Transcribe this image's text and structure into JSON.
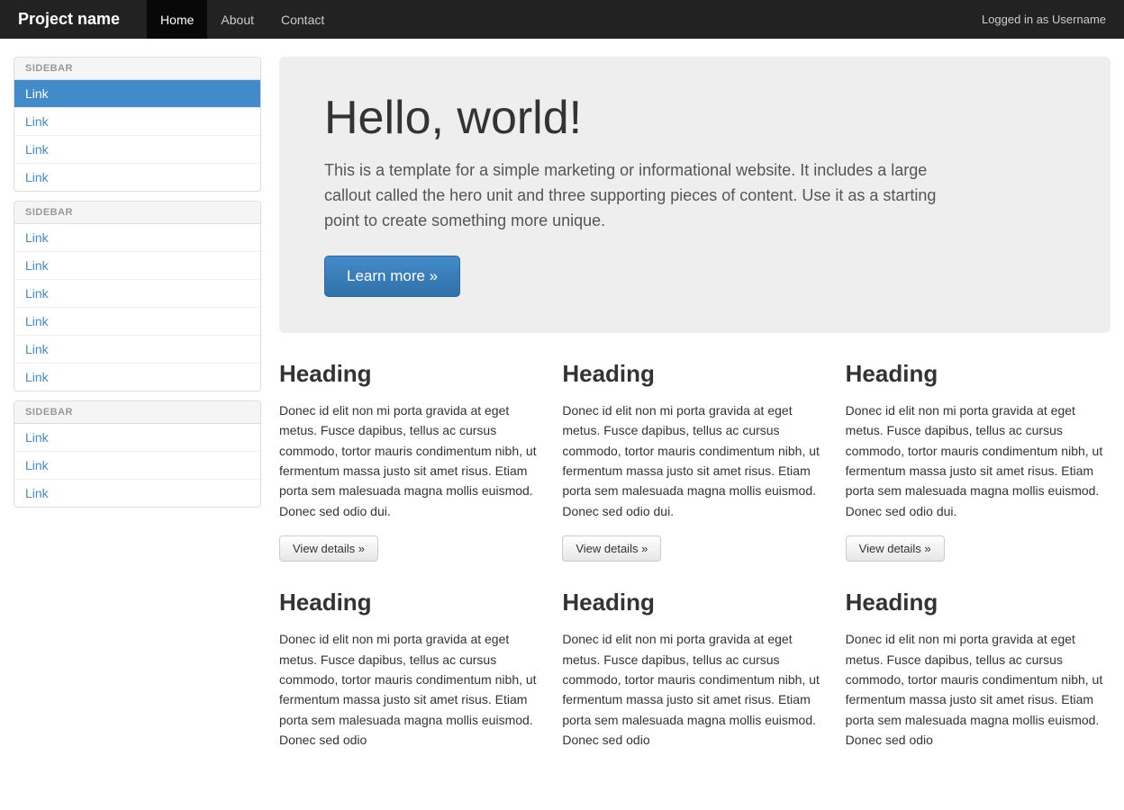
{
  "navbar": {
    "brand": "Project name",
    "nav_items": [
      {
        "label": "Home",
        "active": true
      },
      {
        "label": "About",
        "active": false
      },
      {
        "label": "Contact",
        "active": false
      }
    ],
    "user_text": "Logged in as Username"
  },
  "sidebar": {
    "sections": [
      {
        "heading": "Sidebar",
        "links": [
          {
            "label": "Link",
            "active": true
          },
          {
            "label": "Link",
            "active": false
          },
          {
            "label": "Link",
            "active": false
          },
          {
            "label": "Link",
            "active": false
          }
        ]
      },
      {
        "heading": "Sidebar",
        "links": [
          {
            "label": "Link",
            "active": false
          },
          {
            "label": "Link",
            "active": false
          },
          {
            "label": "Link",
            "active": false
          },
          {
            "label": "Link",
            "active": false
          },
          {
            "label": "Link",
            "active": false
          },
          {
            "label": "Link",
            "active": false
          }
        ]
      },
      {
        "heading": "Sidebar",
        "links": [
          {
            "label": "Link",
            "active": false
          },
          {
            "label": "Link",
            "active": false
          },
          {
            "label": "Link",
            "active": false
          }
        ]
      }
    ]
  },
  "hero": {
    "heading": "Hello, world!",
    "description": "This is a template for a simple marketing or informational website. It includes a large callout called the hero unit and three supporting pieces of content. Use it as a starting point to create something more unique.",
    "button_label": "Learn more »"
  },
  "content_rows": [
    {
      "blocks": [
        {
          "heading": "Heading",
          "body": "Donec id elit non mi porta gravida at eget metus. Fusce dapibus, tellus ac cursus commodo, tortor mauris condimentum nibh, ut fermentum massa justo sit amet risus. Etiam porta sem malesuada magna mollis euismod. Donec sed odio dui.",
          "button_label": "View details »"
        },
        {
          "heading": "Heading",
          "body": "Donec id elit non mi porta gravida at eget metus. Fusce dapibus, tellus ac cursus commodo, tortor mauris condimentum nibh, ut fermentum massa justo sit amet risus. Etiam porta sem malesuada magna mollis euismod. Donec sed odio dui.",
          "button_label": "View details »"
        },
        {
          "heading": "Heading",
          "body": "Donec id elit non mi porta gravida at eget metus. Fusce dapibus, tellus ac cursus commodo, tortor mauris condimentum nibh, ut fermentum massa justo sit amet risus. Etiam porta sem malesuada magna mollis euismod. Donec sed odio dui.",
          "button_label": "View details »"
        }
      ]
    },
    {
      "blocks": [
        {
          "heading": "Heading",
          "body": "Donec id elit non mi porta gravida at eget metus. Fusce dapibus, tellus ac cursus commodo, tortor mauris condimentum nibh, ut fermentum massa justo sit amet risus. Etiam porta sem malesuada magna mollis euismod. Donec sed odio",
          "button_label": ""
        },
        {
          "heading": "Heading",
          "body": "Donec id elit non mi porta gravida at eget metus. Fusce dapibus, tellus ac cursus commodo, tortor mauris condimentum nibh, ut fermentum massa justo sit amet risus. Etiam porta sem malesuada magna mollis euismod. Donec sed odio",
          "button_label": ""
        },
        {
          "heading": "Heading",
          "body": "Donec id elit non mi porta gravida at eget metus. Fusce dapibus, tellus ac cursus commodo, tortor mauris condimentum nibh, ut fermentum massa justo sit amet risus. Etiam porta sem malesuada magna mollis euismod. Donec sed odio",
          "button_label": ""
        }
      ]
    }
  ]
}
